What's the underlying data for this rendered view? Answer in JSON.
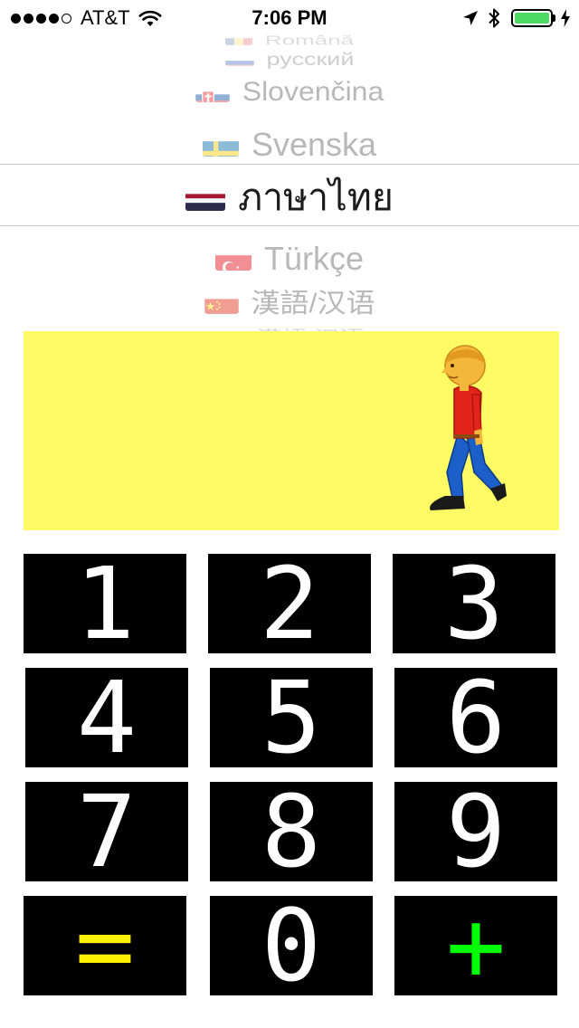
{
  "status_bar": {
    "signal_bars": 5,
    "signal_filled": 4,
    "carrier": "AT&T",
    "time": "7:06 PM",
    "battery_level": 1.0,
    "battery_color": "#4cd964",
    "icons": [
      "wifi-icon",
      "location-arrow-icon",
      "bluetooth-icon",
      "battery-icon",
      "charging-bolt-icon"
    ]
  },
  "language_picker": {
    "rows": [
      {
        "flag": "romania-flag-icon",
        "label": "Română"
      },
      {
        "flag": "russia-flag-icon",
        "label": "русский"
      },
      {
        "flag": "slovakia-flag-icon",
        "label": "Slovenčina"
      },
      {
        "flag": "sweden-flag-icon",
        "label": "Svenska"
      },
      {
        "flag": "thailand-flag-icon",
        "label": "ภาษาไทย"
      },
      {
        "flag": "turkey-flag-icon",
        "label": "Türkçe"
      },
      {
        "flag": "china-flag-icon",
        "label": "漢語/汉语"
      },
      {
        "flag": "china-flag-icon",
        "label": "漢語/汉语"
      }
    ],
    "selected": "ภาษาไทย"
  },
  "display_panel": {
    "background_color": "#fffb64",
    "icon": "person-walking-icon"
  },
  "keypad": {
    "rows": [
      [
        "1",
        "2",
        "3"
      ],
      [
        "4",
        "5",
        "6"
      ],
      [
        "7",
        "8",
        "9"
      ],
      [
        "=",
        "0",
        "+"
      ]
    ],
    "key_background": "#000000",
    "digit_color": "#ffffff",
    "equals_color": "#fff200",
    "plus_color": "#00ff00"
  }
}
